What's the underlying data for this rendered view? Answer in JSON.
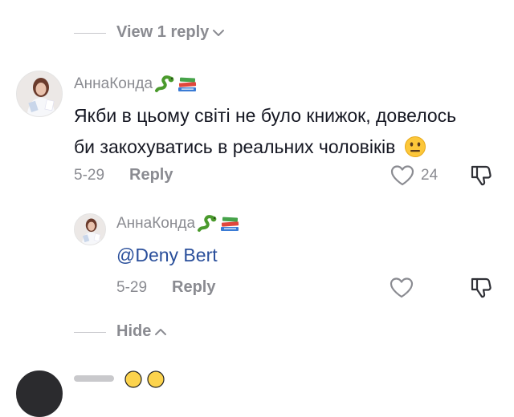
{
  "thread": {
    "view_replies_label": "View 1 reply",
    "hide_label": "Hide"
  },
  "comment": {
    "username": "АннаКонда",
    "text_line1": "Якби в цьому світі не було книжок, довелось",
    "text_line2": "би закохуватись в реальних чоловіків",
    "date": "5-29",
    "reply_label": "Reply",
    "like_count": "24"
  },
  "reply": {
    "username": "АннаКонда",
    "mention": "@Deny Bert",
    "date": "5-29",
    "reply_label": "Reply"
  },
  "icons": {
    "badge_1": "snake-emoji",
    "badge_2": "books-emoji",
    "text_emoji": "neutral-face-emoji",
    "like": "heart-outline-icon",
    "dislike": "thumbs-down-icon",
    "chevron_down": "chevron-down-icon",
    "chevron_up": "chevron-up-icon"
  },
  "colors": {
    "text": "#161823",
    "muted": "#8a8b91",
    "mention": "#2a4f9b",
    "background": "#ffffff"
  }
}
